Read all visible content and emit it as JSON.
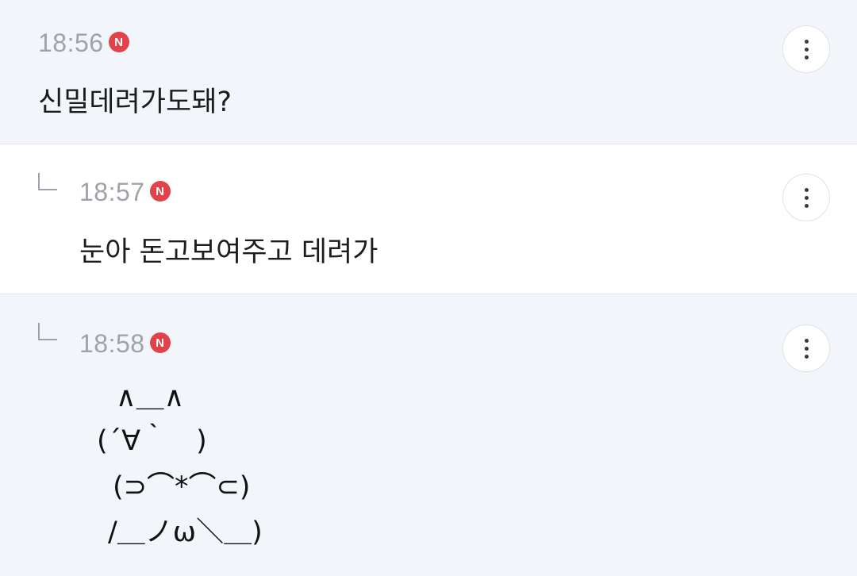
{
  "comments": [
    {
      "time": "18:56",
      "badge": "N",
      "text": "신밀데려가도돼?",
      "is_reply": false
    },
    {
      "time": "18:57",
      "badge": "N",
      "text": "눈아 돈고보여주고 데려가",
      "is_reply": true
    },
    {
      "time": "18:58",
      "badge": "N",
      "is_reply": true,
      "art_lines": [
        "∧＿∧",
        "(´∀｀　)",
        "(⊃⌒*⌒⊂)",
        "/＿ノω＼＿)"
      ]
    }
  ],
  "icons": {
    "more": "vertical-ellipsis-icon",
    "reply": "reply-corner-icon",
    "new": "new-badge-icon"
  },
  "colors": {
    "badge": "#e2434b",
    "time": "#9ea3a9",
    "background": "#f2f6fb"
  }
}
